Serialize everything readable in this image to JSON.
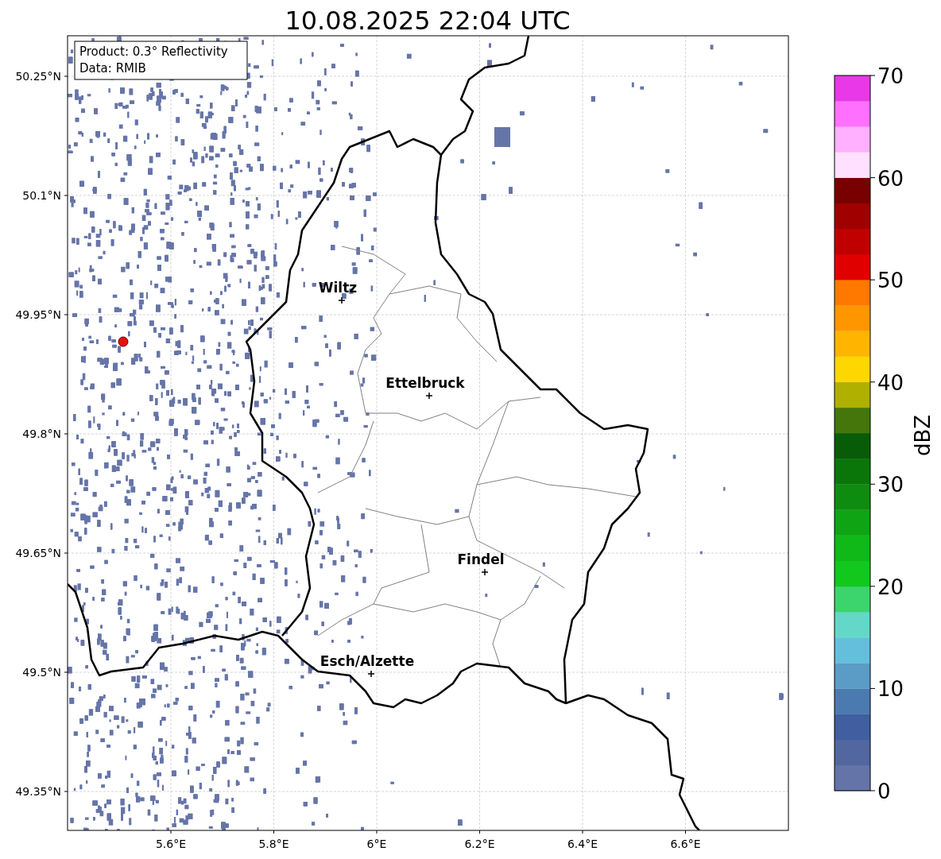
{
  "title": "10.08.2025 22:04 UTC",
  "info_box": [
    "Product: 0.3° Reflectivity",
    "Data: RMIB"
  ],
  "y_ticks": [
    "50.25°N",
    "50.1°N",
    "49.95°N",
    "49.8°N",
    "49.65°N",
    "49.5°N",
    "49.35°N"
  ],
  "x_ticks": [
    "5.6°E",
    "5.8°E",
    "6°E",
    "6.2°E",
    "6.4°E",
    "6.6°E"
  ],
  "cities": [
    {
      "name": "Wiltz"
    },
    {
      "name": "Ettelbruck"
    },
    {
      "name": "Findel"
    },
    {
      "name": "Esch/Alzette"
    }
  ],
  "colorbar": {
    "label": "dBZ",
    "ticks": [
      "70",
      "60",
      "50",
      "40",
      "30",
      "20",
      "10",
      "0"
    ],
    "bins": [
      {
        "color": "#6474a8"
      },
      {
        "color": "#52669f"
      },
      {
        "color": "#415ea1"
      },
      {
        "color": "#4a7ab0"
      },
      {
        "color": "#5a9cc6"
      },
      {
        "color": "#64bfdc"
      },
      {
        "color": "#64d8c8"
      },
      {
        "color": "#3cd46c"
      },
      {
        "color": "#12c81c"
      },
      {
        "color": "#10b818"
      },
      {
        "color": "#0fa414"
      },
      {
        "color": "#0e8c10"
      },
      {
        "color": "#0a760a"
      },
      {
        "color": "#085c08"
      },
      {
        "color": "#44760c"
      },
      {
        "color": "#b0b000"
      },
      {
        "color": "#ffd700"
      },
      {
        "color": "#ffb400"
      },
      {
        "color": "#ff9600"
      },
      {
        "color": "#ff7800"
      },
      {
        "color": "#e00000"
      },
      {
        "color": "#c00000"
      },
      {
        "color": "#a00000"
      },
      {
        "color": "#780000"
      },
      {
        "color": "#ffe0ff"
      },
      {
        "color": "#ffb0ff"
      },
      {
        "color": "#ff70ff"
      },
      {
        "color": "#e838e8"
      }
    ]
  }
}
